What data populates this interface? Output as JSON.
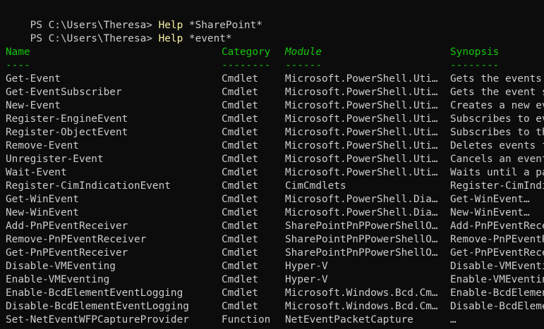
{
  "commands": [
    {
      "prompt": "PS C:\\Users\\Theresa> ",
      "cmd": "Help",
      "arg": " *SharePoint*"
    },
    {
      "prompt": "PS C:\\Users\\Theresa> ",
      "cmd": "Help",
      "arg": " *event*"
    }
  ],
  "table": {
    "headers": {
      "name": "Name",
      "category": "Category",
      "module": "Module",
      "synopsis": "Synopsis"
    },
    "underlines": {
      "name": "----",
      "category": "--------",
      "module": "------",
      "synopsis": "--------"
    },
    "rows": [
      {
        "name": "Get-Event",
        "category": "Cmdlet",
        "module": "Microsoft.PowerShell.Uti…",
        "synopsis": "Gets the events in"
      },
      {
        "name": "Get-EventSubscriber",
        "category": "Cmdlet",
        "module": "Microsoft.PowerShell.Uti…",
        "synopsis": "Gets the event subs"
      },
      {
        "name": "New-Event",
        "category": "Cmdlet",
        "module": "Microsoft.PowerShell.Uti…",
        "synopsis": "Creates a new event"
      },
      {
        "name": "Register-EngineEvent",
        "category": "Cmdlet",
        "module": "Microsoft.PowerShell.Uti…",
        "synopsis": "Subscribes to event"
      },
      {
        "name": "Register-ObjectEvent",
        "category": "Cmdlet",
        "module": "Microsoft.PowerShell.Uti…",
        "synopsis": "Subscribes to the e"
      },
      {
        "name": "Remove-Event",
        "category": "Cmdlet",
        "module": "Microsoft.PowerShell.Uti…",
        "synopsis": "Deletes events from"
      },
      {
        "name": "Unregister-Event",
        "category": "Cmdlet",
        "module": "Microsoft.PowerShell.Uti…",
        "synopsis": "Cancels an event su"
      },
      {
        "name": "Wait-Event",
        "category": "Cmdlet",
        "module": "Microsoft.PowerShell.Uti…",
        "synopsis": "Waits until a parti"
      },
      {
        "name": "Register-CimIndicationEvent",
        "category": "Cmdlet",
        "module": "CimCmdlets",
        "synopsis": "Register-CimIndicat"
      },
      {
        "name": "Get-WinEvent",
        "category": "Cmdlet",
        "module": "Microsoft.PowerShell.Dia…",
        "synopsis": "Get-WinEvent…"
      },
      {
        "name": "New-WinEvent",
        "category": "Cmdlet",
        "module": "Microsoft.PowerShell.Dia…",
        "synopsis": "New-WinEvent…"
      },
      {
        "name": "Add-PnPEventReceiver",
        "category": "Cmdlet",
        "module": "SharePointPnPPowerShellO…",
        "synopsis": "Add-PnPEventReceive"
      },
      {
        "name": "Remove-PnPEventReceiver",
        "category": "Cmdlet",
        "module": "SharePointPnPPowerShellO…",
        "synopsis": "Remove-PnPEventRece"
      },
      {
        "name": "Get-PnPEventReceiver",
        "category": "Cmdlet",
        "module": "SharePointPnPPowerShellO…",
        "synopsis": "Get-PnPEventReceive"
      },
      {
        "name": "Disable-VMEventing",
        "category": "Cmdlet",
        "module": "Hyper-V",
        "synopsis": "Disable-VMEventing…"
      },
      {
        "name": "Enable-VMEventing",
        "category": "Cmdlet",
        "module": "Hyper-V",
        "synopsis": "Enable-VMEventing…"
      },
      {
        "name": "Enable-BcdElementEventLogging",
        "category": "Cmdlet",
        "module": "Microsoft.Windows.Bcd.Cm…",
        "synopsis": "Enable-BcdElementEv"
      },
      {
        "name": "Disable-BcdElementEventLogging",
        "category": "Cmdlet",
        "module": "Microsoft.Windows.Bcd.Cm…",
        "synopsis": "Disable-BcdElementE"
      },
      {
        "name": "Set-NetEventWFPCaptureProvider",
        "category": "Function",
        "module": "NetEventPacketCapture",
        "synopsis": "…"
      }
    ]
  },
  "colors": {
    "background": "#0c0c0c",
    "text": "#cccccc",
    "command": "#f9f1a5",
    "header": "#16c60c"
  }
}
